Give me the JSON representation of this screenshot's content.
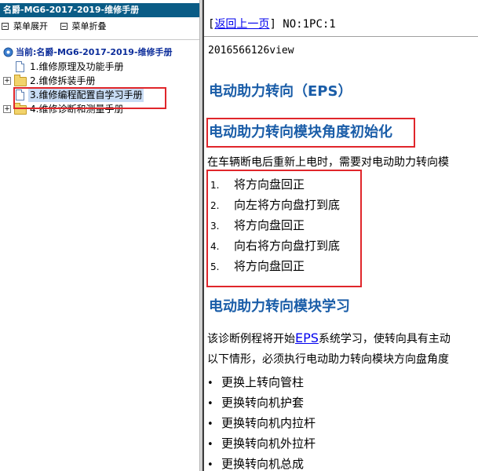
{
  "left_pane": {
    "title": "名爵-MG6-2017-2019-维修手册",
    "menu": {
      "expand_all": "菜单展开",
      "collapse_all": "菜单折叠"
    },
    "tree": {
      "root_label": "当前:名爵-MG6-2017-2019-维修手册",
      "items": [
        {
          "label": "1.维修原理及功能手册",
          "icon": "page-icon",
          "expandable": false
        },
        {
          "label": "2.维修拆装手册",
          "icon": "folder-icon",
          "expandable": true
        },
        {
          "label": "3.维修编程配置自学习手册",
          "icon": "page-icon",
          "expandable": false,
          "selected": true
        },
        {
          "label": "4.维修诊断和测量手册",
          "icon": "folder-icon",
          "expandable": true
        }
      ]
    }
  },
  "document": {
    "back_link": "返回上一页",
    "page_info": "NO:1PC:1",
    "doc_id": "2016566126view",
    "section_title": "电动助力转向（EPS）",
    "sub1_title": "电动助力转向模块角度初始化",
    "sub1_intro": "在车辆断电后重新上电时，需要对电动助力转向模",
    "steps": [
      "将方向盘回正",
      "向左将方向盘打到底",
      "将方向盘回正",
      "向右将方向盘打到底",
      "将方向盘回正"
    ],
    "step_numbers": [
      "1.",
      "2.",
      "3.",
      "4.",
      "5."
    ],
    "sub2_title": "电动助力转向模块学习",
    "sub2_line1_pre": "该诊断例程将开始",
    "sub2_line1_link": "EPS",
    "sub2_line1_post": "系统学习，使转向具有主动",
    "sub2_line2": "以下情形，必须执行电动助力转向模块方向盘角度",
    "bullets": [
      "更换上转向管柱",
      "更换转向机护套",
      "更换转向机内拉杆",
      "更换转向机外拉杆",
      "更换转向机总成"
    ],
    "bullet_char": "•"
  },
  "colors": {
    "title_bar": "#0a5c86",
    "heading_blue": "#1a5da8",
    "link_blue": "#0000ee",
    "highlight_red": "#e0262b",
    "selection": "#c7dbf4"
  }
}
